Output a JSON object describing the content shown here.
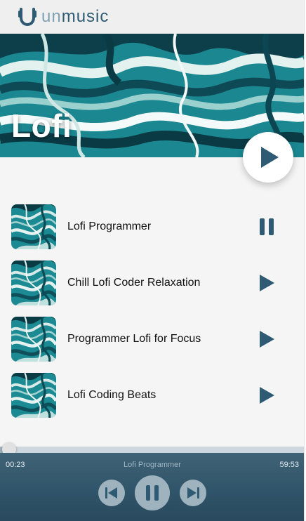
{
  "app": {
    "brand_prefix": "un",
    "brand_suffix": "music"
  },
  "playlist": {
    "title": "Lofi"
  },
  "tracks": [
    {
      "title": "Lofi Programmer",
      "state": "playing"
    },
    {
      "title": "Chill Lofi Coder Relaxation",
      "state": "paused"
    },
    {
      "title": "Programmer Lofi for Focus",
      "state": "paused"
    },
    {
      "title": "Lofi Coding Beats",
      "state": "paused"
    }
  ],
  "player": {
    "elapsed": "00:23",
    "now_playing": "Lofi Programmer",
    "duration": "59:53",
    "progress": 0.01
  },
  "colors": {
    "accent": "#2e5b73",
    "player_bg": "#34596e",
    "control_bg": "#9fb3bf",
    "hero_teal": "#1f8a94"
  },
  "icons": {
    "logo": "headphone-u-icon",
    "hero_play": "play-icon",
    "track_playing": "pause-icon",
    "track_idle": "play-icon",
    "prev": "skip-previous-icon",
    "pause": "pause-icon",
    "next": "skip-next-icon"
  }
}
